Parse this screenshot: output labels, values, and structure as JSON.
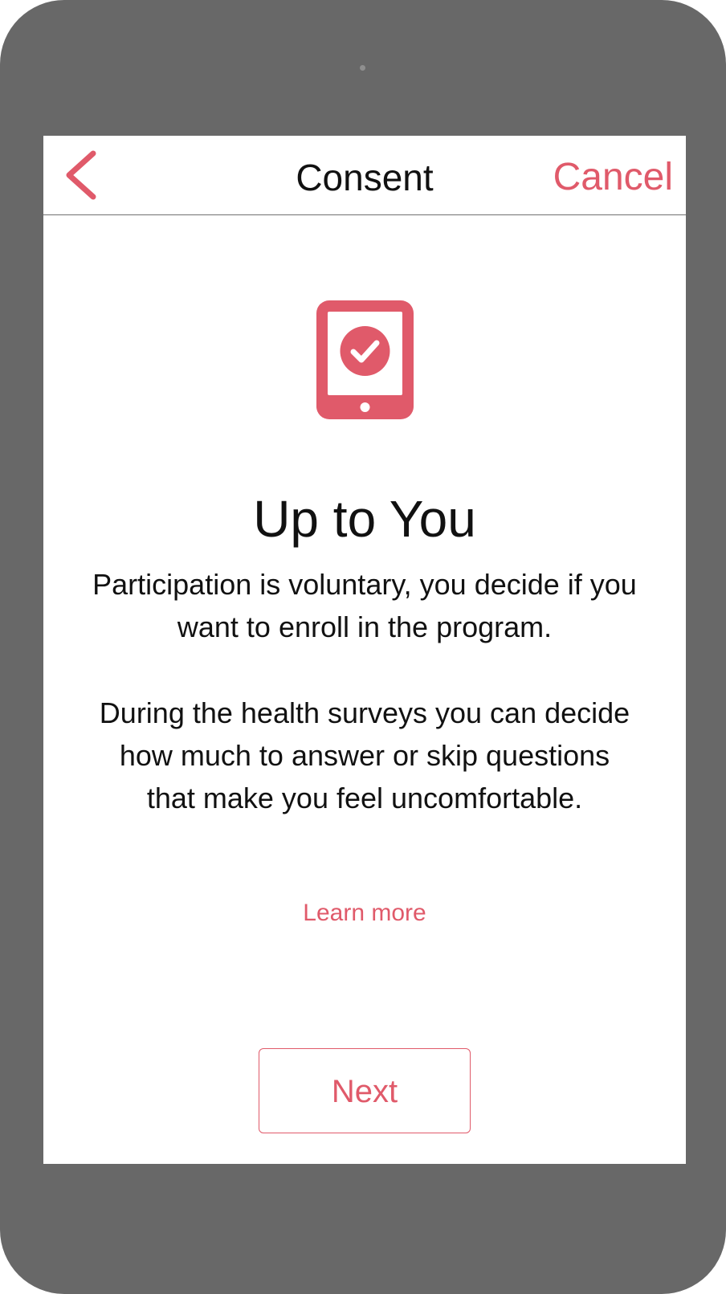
{
  "colors": {
    "accent": "#e05a6a",
    "device_frame": "#686868",
    "text": "#111111",
    "screen_bg": "#ffffff"
  },
  "navbar": {
    "back_icon": "chevron-left-icon",
    "title": "Consent",
    "cancel_label": "Cancel"
  },
  "content": {
    "icon": "tablet-check-icon",
    "heading": "Up to You",
    "paragraph_1": "Participation is voluntary, you decide if you want to enroll in the program.",
    "paragraph_2": "During the health surveys you can decide how much to answer or skip questions that make you feel uncomfortable.",
    "learn_more_label": "Learn more"
  },
  "footer": {
    "next_label": "Next"
  }
}
